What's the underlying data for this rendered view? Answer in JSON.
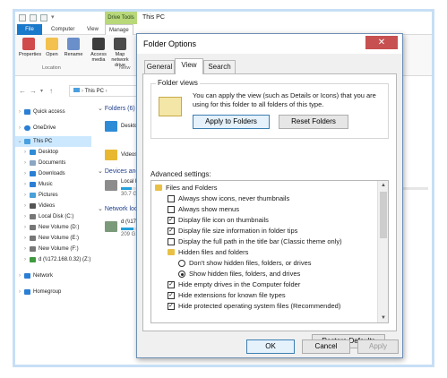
{
  "explorer": {
    "window_title": "This PC",
    "contextual_tab": "Drive Tools",
    "ribbon_tabs": [
      "File",
      "Computer",
      "View",
      "Manage"
    ],
    "ribbon_buttons": [
      {
        "label": "Properties",
        "icon": "properties-icon",
        "color": "#d04b4b"
      },
      {
        "label": "Open",
        "icon": "open-icon",
        "color": "#f2c14e"
      },
      {
        "label": "Rename",
        "icon": "rename-icon",
        "color": "#6a8fc9"
      },
      {
        "label": "Access media",
        "icon": "media-icon",
        "color": "#3d3d3d"
      },
      {
        "label": "Map network drive",
        "icon": "network-drive-icon",
        "color": "#4b4b4b"
      }
    ],
    "ribbon_groups": [
      "Location",
      "Netw"
    ],
    "address": "This PC",
    "nav_items": [
      {
        "label": "Quick access",
        "icon": "star-icon",
        "color": "#2a7fd4"
      },
      {
        "label": "OneDrive",
        "icon": "cloud-icon",
        "color": "#2a7fd4"
      },
      {
        "label": "This PC",
        "icon": "computer-icon",
        "color": "#4a9fe0"
      },
      {
        "label": "Desktop",
        "icon": "desktop-icon",
        "color": "#2e8bd6"
      },
      {
        "label": "Documents",
        "icon": "documents-icon",
        "color": "#8aa6c2"
      },
      {
        "label": "Downloads",
        "icon": "downloads-icon",
        "color": "#2a7fd4"
      },
      {
        "label": "Music",
        "icon": "music-icon",
        "color": "#2a7fd4"
      },
      {
        "label": "Pictures",
        "icon": "pictures-icon",
        "color": "#4aa0d8"
      },
      {
        "label": "Videos",
        "icon": "videos-icon",
        "color": "#555555"
      },
      {
        "label": "Local Disk (C:)",
        "icon": "drive-icon",
        "color": "#777777"
      },
      {
        "label": "New Volume (D:)",
        "icon": "drive-icon",
        "color": "#777777"
      },
      {
        "label": "New Volume (E:)",
        "icon": "drive-icon",
        "color": "#777777"
      },
      {
        "label": "New Volume (F:)",
        "icon": "drive-icon",
        "color": "#777777"
      },
      {
        "label": "d (\\\\172.168.0.32) (Z:)",
        "icon": "network-drive-icon",
        "color": "#3f9a3f"
      },
      {
        "label": "Network",
        "icon": "network-icon",
        "color": "#2a7fd4"
      },
      {
        "label": "Homegroup",
        "icon": "homegroup-icon",
        "color": "#2a7fd4"
      }
    ],
    "sections": {
      "folders": "Folders (6)",
      "devices": "Devices and",
      "network": "Network loca"
    },
    "content_items": {
      "desktop": "Deskto",
      "videos": "Videos",
      "local_disk": "Local D",
      "local_disk_size": "30.7 G",
      "net_drive": "d (\\\\17",
      "net_drive_size": "209 G"
    }
  },
  "dialog": {
    "title": "Folder Options",
    "close_glyph": "✕",
    "tabs": [
      "General",
      "View",
      "Search"
    ],
    "active_tab": "View",
    "folder_views_label": "Folder views",
    "folder_views_text": "You can apply the view (such as Details or Icons) that you are using for this folder to all folders of this type.",
    "apply_button": "Apply to Folders",
    "reset_button": "Reset Folders",
    "advanced_label": "Advanced settings:",
    "advanced_items": [
      {
        "type": "folder",
        "label": "Files and Folders",
        "indent": 0
      },
      {
        "type": "checkbox",
        "label": "Always show icons, never thumbnails",
        "checked": false,
        "indent": 1
      },
      {
        "type": "checkbox",
        "label": "Always show menus",
        "checked": false,
        "indent": 1
      },
      {
        "type": "checkbox",
        "label": "Display file icon on thumbnails",
        "checked": true,
        "indent": 1
      },
      {
        "type": "checkbox",
        "label": "Display file size information in folder tips",
        "checked": true,
        "indent": 1
      },
      {
        "type": "checkbox",
        "label": "Display the full path in the title bar (Classic theme only)",
        "checked": false,
        "indent": 1
      },
      {
        "type": "folder",
        "label": "Hidden files and folders",
        "indent": 1
      },
      {
        "type": "radio",
        "label": "Don't show hidden files, folders, or drives",
        "checked": false,
        "indent": 2
      },
      {
        "type": "radio",
        "label": "Show hidden files, folders, and drives",
        "checked": true,
        "indent": 2
      },
      {
        "type": "checkbox",
        "label": "Hide empty drives in the Computer folder",
        "checked": true,
        "indent": 1
      },
      {
        "type": "checkbox",
        "label": "Hide extensions for known file types",
        "checked": true,
        "indent": 1
      },
      {
        "type": "checkbox",
        "label": "Hide protected operating system files (Recommended)",
        "checked": true,
        "indent": 1
      }
    ],
    "restore_button": "Restore Defaults",
    "ok_button": "OK",
    "cancel_button": "Cancel",
    "apply_button_bottom": "Apply"
  }
}
